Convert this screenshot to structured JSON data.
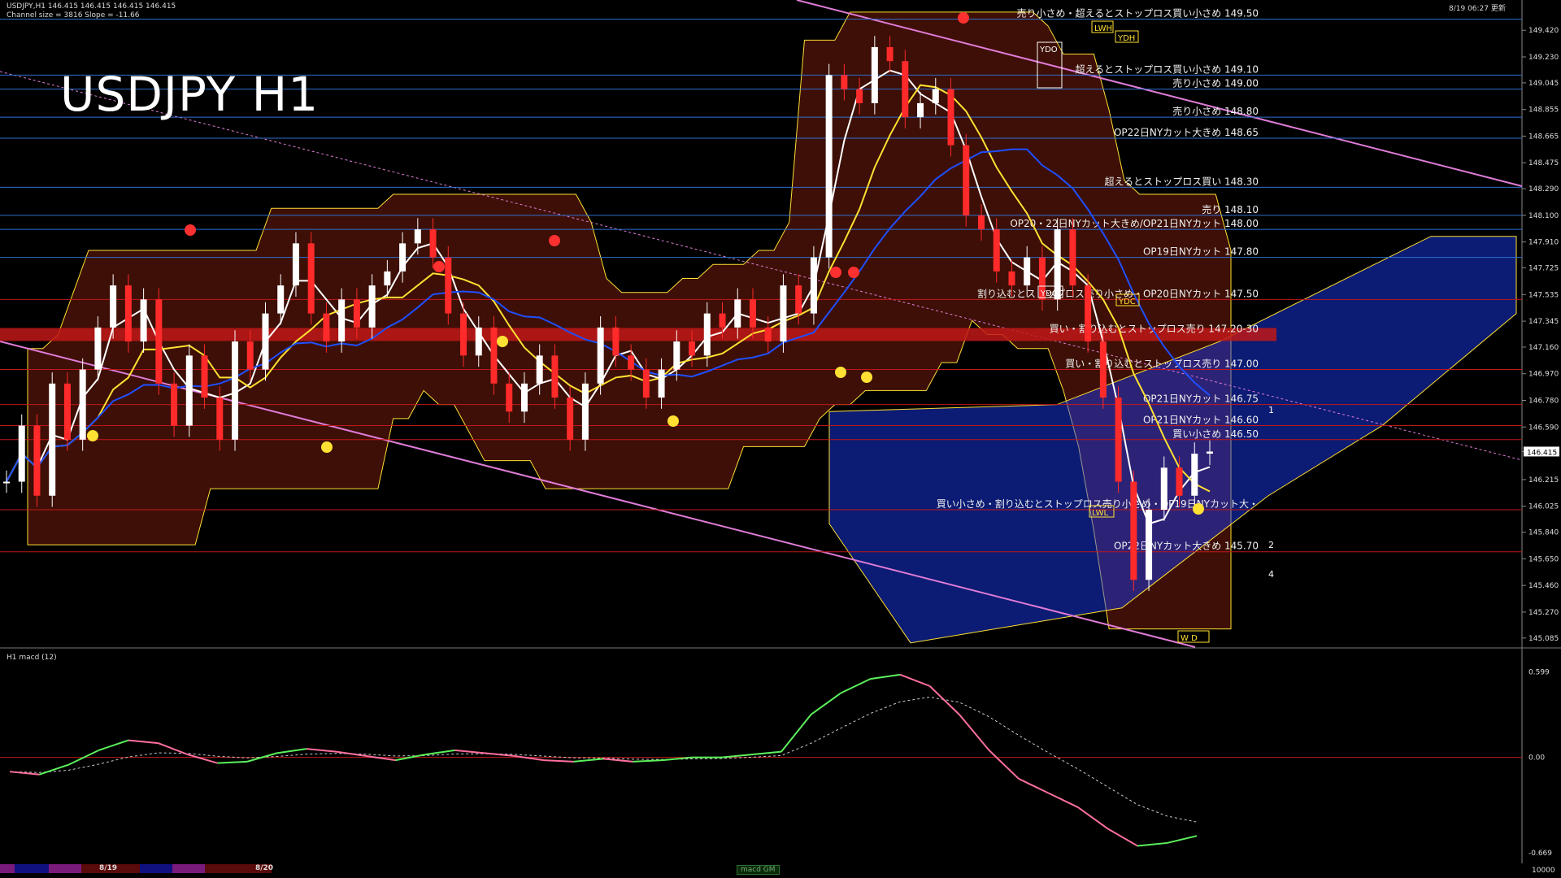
{
  "header": {
    "symbol_line": "USDJPY,H1  146.415 146.415 146.415 146.415",
    "channel_line": "Channel size = 3816 Slope = -11.66",
    "timestamp": "8/19 06:27 更新"
  },
  "title": "USDJPY H1",
  "colors": {
    "background": "#000000",
    "bull_candle": "#ffffff",
    "bear_candle": "#ff2a2a",
    "sma_white": "#ffffff",
    "sma_yellow": "#ffe033",
    "sma_blue": "#1f4fff",
    "cloud_bear": "#b02a10",
    "cloud_bull": "#1a3cff",
    "channel": "#e07cd8",
    "level_blue": "#2f6fd0",
    "level_red": "#c01818",
    "macd_up": "#5cf05c",
    "macd_down": "#ff6fa0"
  },
  "price_axis": {
    "ticks": [
      "149.420",
      "149.230",
      "149.045",
      "148.855",
      "148.665",
      "148.475",
      "148.290",
      "148.100",
      "147.910",
      "147.725",
      "147.535",
      "147.345",
      "147.160",
      "146.970",
      "146.780",
      "146.590",
      "146.415",
      "146.215",
      "146.025",
      "145.840",
      "145.650",
      "145.460",
      "145.270",
      "145.085"
    ],
    "current": "146.415"
  },
  "macd_panel": {
    "label": "H1  macd (12)",
    "ticks": [
      "0.599",
      "0.00",
      "-0.669"
    ]
  },
  "levels": [
    {
      "label": "売り小さめ・超えるとストップロス買い小さめ 149.50",
      "price": 149.5,
      "color": "blue"
    },
    {
      "label": "超えるとストップロス買い小さめ 149.10",
      "price": 149.1,
      "color": "blue"
    },
    {
      "label": "売り小さめ 149.00",
      "price": 149.0,
      "color": "blue"
    },
    {
      "label": "売り小さめ 148.80",
      "price": 148.8,
      "color": "blue"
    },
    {
      "label": "OP22日NYカット大きめ 148.65",
      "price": 148.65,
      "color": "blue"
    },
    {
      "label": "超えるとストップロス買い 148.30",
      "price": 148.3,
      "color": "blue"
    },
    {
      "label": "売り 148.10",
      "price": 148.1,
      "color": "blue"
    },
    {
      "label": "OP20・22日NYカット大きめ/OP21日NYカット 148.00",
      "price": 148.0,
      "color": "blue"
    },
    {
      "label": "OP19日NYカット 147.80",
      "price": 147.8,
      "color": "blue"
    },
    {
      "label": "割り込むとストップロス売り小さめ・OP20日NYカット 147.50",
      "price": 147.5,
      "color": "red"
    },
    {
      "label": "買い・割り込むとストップロス売り 147.20-30",
      "price": 147.25,
      "color": "redband"
    },
    {
      "label": "買い・割り込むとストップロス売り 147.00",
      "price": 147.0,
      "color": "red"
    },
    {
      "label": "OP21日NYカット 146.75",
      "price": 146.75,
      "color": "red"
    },
    {
      "label": "OP21日NYカット 146.60",
      "price": 146.6,
      "color": "red"
    },
    {
      "label": "買い小さめ 146.50",
      "price": 146.5,
      "color": "red"
    },
    {
      "label": "買い小さめ・割り込むとストップロス売り小さめ・OP19日NYカット大・",
      "price": 146.0,
      "color": "red"
    },
    {
      "label": "OP22日NYカット大きめ 145.70",
      "price": 145.7,
      "color": "red"
    }
  ],
  "markers": {
    "ydo": "YDO",
    "lwh": "LWH",
    "ydh": "YDH",
    "ydc": "YDC",
    "ydc2": "YDC",
    "lwl": "LWL",
    "wd": "W D",
    "n1": "1",
    "n2": "2",
    "n4": "4"
  },
  "bottom_bar": {
    "date1": "8/19",
    "date2": "8/20",
    "tab": "macd GM",
    "right_value": "10000"
  },
  "chart_data": {
    "type": "candlestick",
    "title": "USDJPY H1",
    "ylim": [
      145.085,
      149.42
    ],
    "close_series": [
      146.2,
      146.6,
      146.1,
      146.9,
      146.5,
      147.0,
      147.3,
      147.6,
      147.2,
      147.5,
      146.9,
      146.6,
      147.1,
      146.8,
      146.5,
      147.2,
      147.0,
      147.4,
      147.6,
      147.9,
      147.4,
      147.2,
      147.5,
      147.3,
      147.6,
      147.7,
      147.9,
      148.0,
      147.8,
      147.4,
      147.1,
      147.3,
      146.9,
      146.7,
      146.9,
      147.1,
      146.8,
      146.5,
      146.9,
      147.3,
      147.1,
      147.0,
      146.8,
      147.0,
      147.2,
      147.1,
      147.4,
      147.3,
      147.5,
      147.3,
      147.2,
      147.6,
      147.4,
      147.8,
      149.1,
      149.0,
      148.9,
      149.3,
      149.2,
      148.8,
      148.9,
      149.0,
      148.6,
      148.1,
      148.0,
      147.7,
      147.6,
      147.8,
      147.5,
      148.0,
      147.6,
      147.2,
      146.8,
      146.2,
      145.5,
      146.0,
      146.3,
      146.1,
      146.4,
      146.415
    ],
    "macd": [
      -0.1,
      -0.12,
      -0.05,
      0.05,
      0.12,
      0.1,
      0.02,
      -0.04,
      -0.03,
      0.03,
      0.06,
      0.04,
      0.01,
      -0.02,
      0.02,
      0.05,
      0.03,
      0.01,
      -0.02,
      -0.03,
      -0.01,
      -0.03,
      -0.02,
      0.0,
      0.0,
      0.02,
      0.04,
      0.3,
      0.45,
      0.55,
      0.58,
      0.5,
      0.3,
      0.05,
      -0.15,
      -0.25,
      -0.35,
      -0.5,
      -0.62,
      -0.6,
      -0.55
    ]
  }
}
